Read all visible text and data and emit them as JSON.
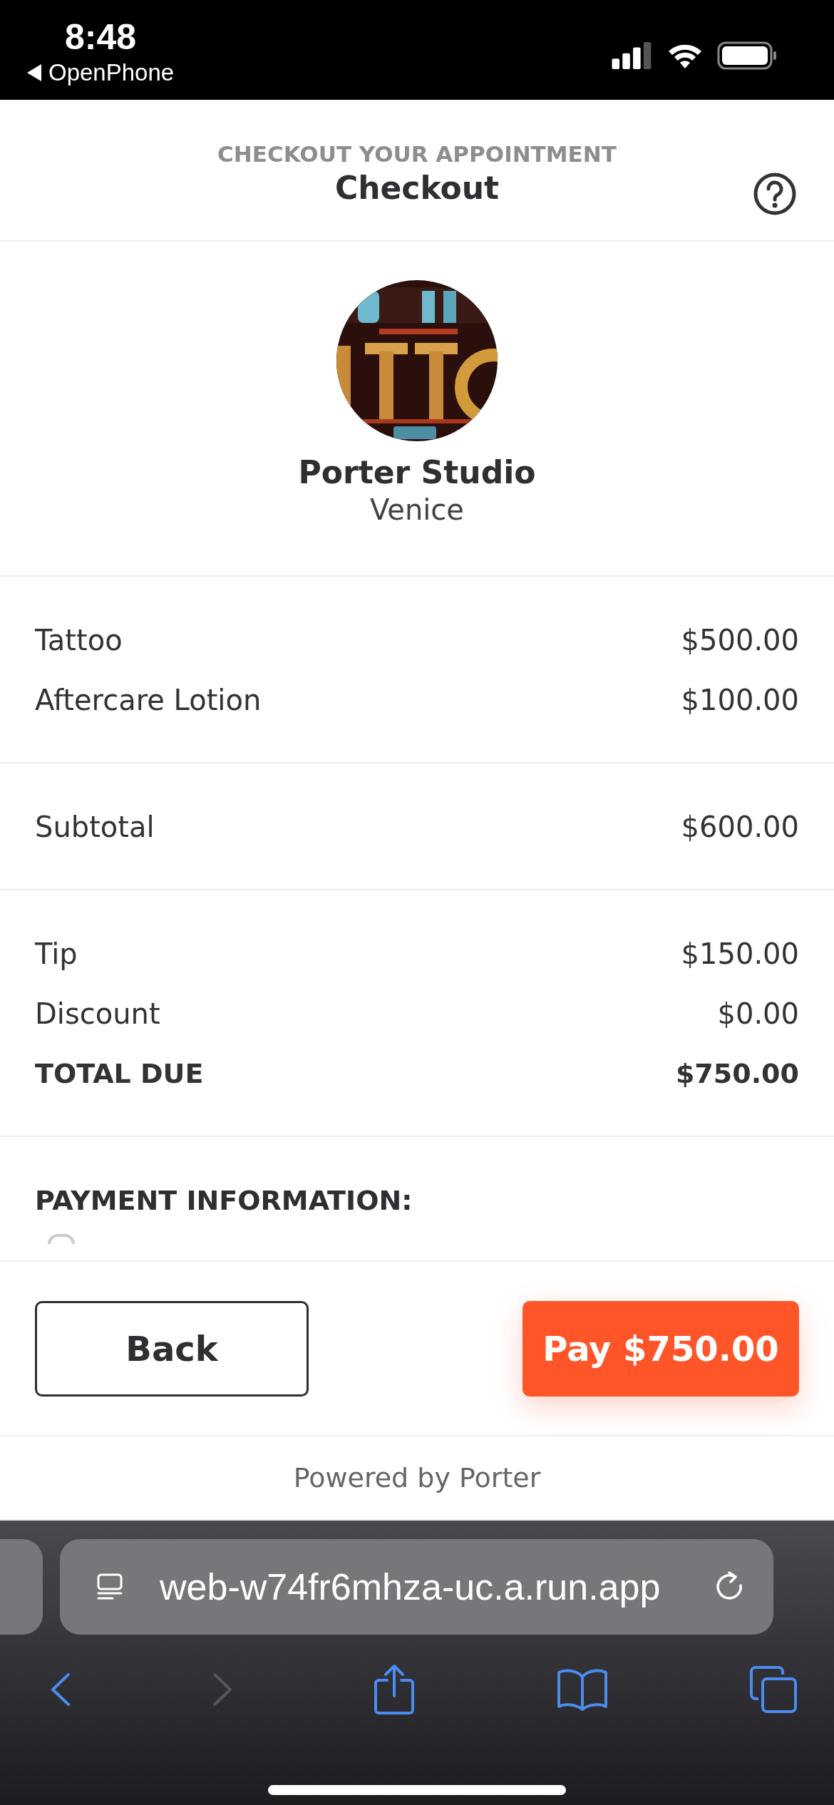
{
  "status_bar": {
    "time": "8:48",
    "back_app": "OpenPhone"
  },
  "header": {
    "subtitle": "CHECKOUT YOUR APPOINTMENT",
    "title": "Checkout"
  },
  "business": {
    "name": "Porter Studio",
    "location": "Venice"
  },
  "summary_sections": [
    {
      "rows": [
        {
          "kind": "item",
          "label": "Tattoo",
          "amount": "$500.00"
        },
        {
          "kind": "item",
          "label": "Aftercare Lotion",
          "amount": "$100.00"
        }
      ]
    },
    {
      "rows": [
        {
          "kind": "item",
          "label": "Subtotal",
          "amount": "$600.00"
        }
      ]
    },
    {
      "rows": [
        {
          "kind": "item",
          "label": "Tip",
          "amount": "$150.00"
        },
        {
          "kind": "item",
          "label": "Discount",
          "amount": "$0.00"
        },
        {
          "kind": "total",
          "label": "TOTAL DUE",
          "amount": "$750.00"
        }
      ]
    }
  ],
  "payment": {
    "heading": "PAYMENT INFORMATION:"
  },
  "actions": [
    {
      "kind": "secondary",
      "label": "Back"
    },
    {
      "kind": "primary",
      "label": "Pay $750.00"
    }
  ],
  "footer": {
    "text": "Powered by Porter"
  },
  "browser": {
    "url": "web-w74fr6mhza-uc.a.run.app",
    "toolbar": [
      {
        "kind": "back",
        "disabled": false
      },
      {
        "kind": "forward",
        "disabled": true
      },
      {
        "kind": "share",
        "disabled": false
      },
      {
        "kind": "bookmarks",
        "disabled": false
      },
      {
        "kind": "tabs",
        "disabled": false
      }
    ]
  }
}
